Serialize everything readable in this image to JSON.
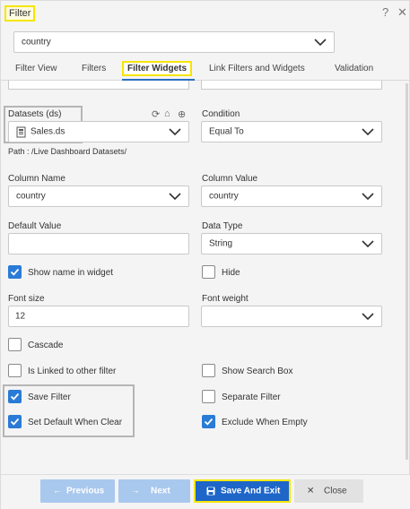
{
  "window": {
    "title": "Filter",
    "help_icon": "question-icon",
    "close_icon": "close-icon"
  },
  "filter_select": {
    "value": "country"
  },
  "tabs": [
    {
      "label": "Filter View"
    },
    {
      "label": "Filters"
    },
    {
      "label": "Filter Widgets",
      "active": true
    },
    {
      "label": "Link Filters and Widgets"
    },
    {
      "label": "Validation"
    }
  ],
  "form": {
    "datasets": {
      "label": "Datasets (ds)",
      "value": "Sales.ds",
      "path": "Path : /Live Dashboard Datasets/"
    },
    "condition": {
      "label": "Condition",
      "value": "Equal To"
    },
    "column_name": {
      "label": "Column Name",
      "value": "country"
    },
    "column_value": {
      "label": "Column Value",
      "value": "country"
    },
    "default_value": {
      "label": "Default Value",
      "value": ""
    },
    "data_type": {
      "label": "Data Type",
      "value": "String"
    },
    "show_name": {
      "label": "Show name in widget",
      "checked": true
    },
    "hide": {
      "label": "Hide",
      "checked": false
    },
    "font_size": {
      "label": "Font size",
      "value": "12"
    },
    "font_weight": {
      "label": "Font weight",
      "value": ""
    },
    "cascade": {
      "label": "Cascade",
      "checked": false
    },
    "is_linked": {
      "label": "Is Linked to other filter",
      "checked": false
    },
    "show_search_box": {
      "label": "Show Search Box",
      "checked": false
    },
    "save_filter": {
      "label": "Save Filter",
      "checked": true
    },
    "separate_filter": {
      "label": "Separate Filter",
      "checked": false
    },
    "set_default": {
      "label": "Set Default When Clear",
      "checked": true
    },
    "exclude_empty": {
      "label": "Exclude When Empty",
      "checked": true
    }
  },
  "footer": {
    "previous": "Previous",
    "next": "Next",
    "save_exit": "Save And Exit",
    "close": "Close"
  },
  "colors": {
    "accent": "#1e66c8",
    "checkbox": "#2a7bd6",
    "highlight": "#f5e600",
    "disabled_button": "#a9c8ee"
  }
}
